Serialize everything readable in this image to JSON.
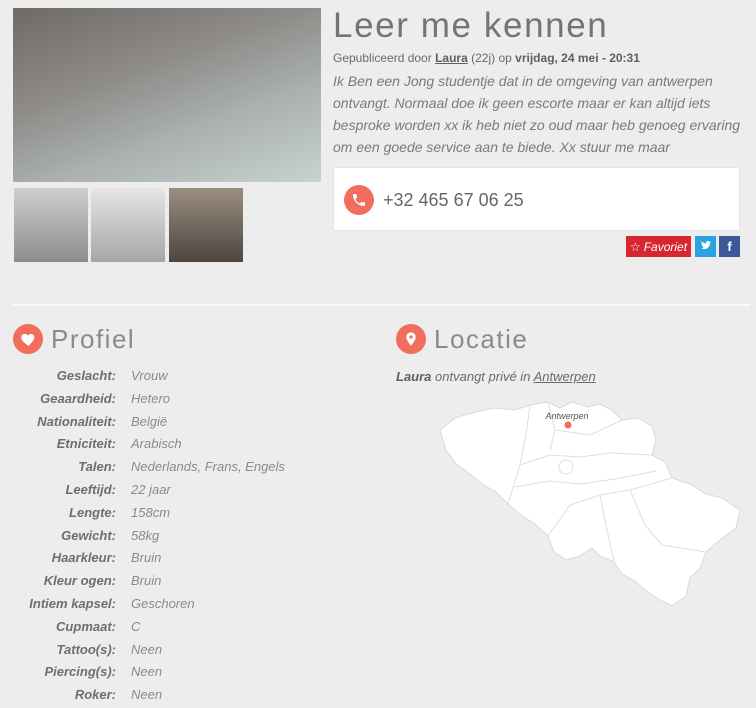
{
  "title": "Leer me kennen",
  "meta": {
    "published_by": "Gepubliceerd door",
    "name": "Laura",
    "age": "(22j)",
    "on": "op",
    "date": "vrijdag, 24 mei - 20:31"
  },
  "description": [
    "Ik Ben een Jong studentje dat in de omgeving van antwerpen",
    "ontvangt. Normaal doe ik geen escorte maar er kan altijd iets",
    "besproke worden xx ik heb niet zo oud maar heb genoeg ervaring",
    "om een goede service aan te biede. Xx stuur me maar"
  ],
  "phone": {
    "number": "+32 465 67 06 25",
    "icon": "phone-icon"
  },
  "actions": {
    "favorite": "Favoriet",
    "favorite_icon": "star-icon",
    "twitter_icon": "twitter-icon",
    "facebook_icon": "facebook-icon",
    "facebook_glyph": "f"
  },
  "profile": {
    "title": "Profiel",
    "icon": "heart-icon",
    "rows": [
      {
        "label": "Geslacht:",
        "value": "Vrouw"
      },
      {
        "label": "Geaardheid:",
        "value": "Hetero"
      },
      {
        "label": "Nationaliteit:",
        "value": "België"
      },
      {
        "label": "Etniciteit:",
        "value": "Arabisch"
      },
      {
        "label": "Talen:",
        "value": "Nederlands, Frans, Engels"
      },
      {
        "label": "Leeftijd:",
        "value": "22 jaar"
      },
      {
        "label": "Lengte:",
        "value": "158cm"
      },
      {
        "label": "Gewicht:",
        "value": "58kg"
      },
      {
        "label": "Haarkleur:",
        "value": "Bruin"
      },
      {
        "label": "Kleur ogen:",
        "value": "Bruin"
      },
      {
        "label": "Intiem kapsel:",
        "value": "Geschoren"
      },
      {
        "label": "Cupmaat:",
        "value": "C"
      },
      {
        "label": "Tattoo(s):",
        "value": "Neen"
      },
      {
        "label": "Piercing(s):",
        "value": "Neen"
      },
      {
        "label": "Roker:",
        "value": "Neen"
      }
    ]
  },
  "location": {
    "title": "Locatie",
    "icon": "map-pin-icon",
    "name": "Laura",
    "text": "ontvangt privé in",
    "city": "Antwerpen",
    "map_label": "Antwerpen"
  },
  "colors": {
    "background": "#ededed",
    "accent": "#f26d5e",
    "favorite": "#d6262f",
    "twitter": "#2aa3de",
    "facebook": "#3b5998"
  }
}
